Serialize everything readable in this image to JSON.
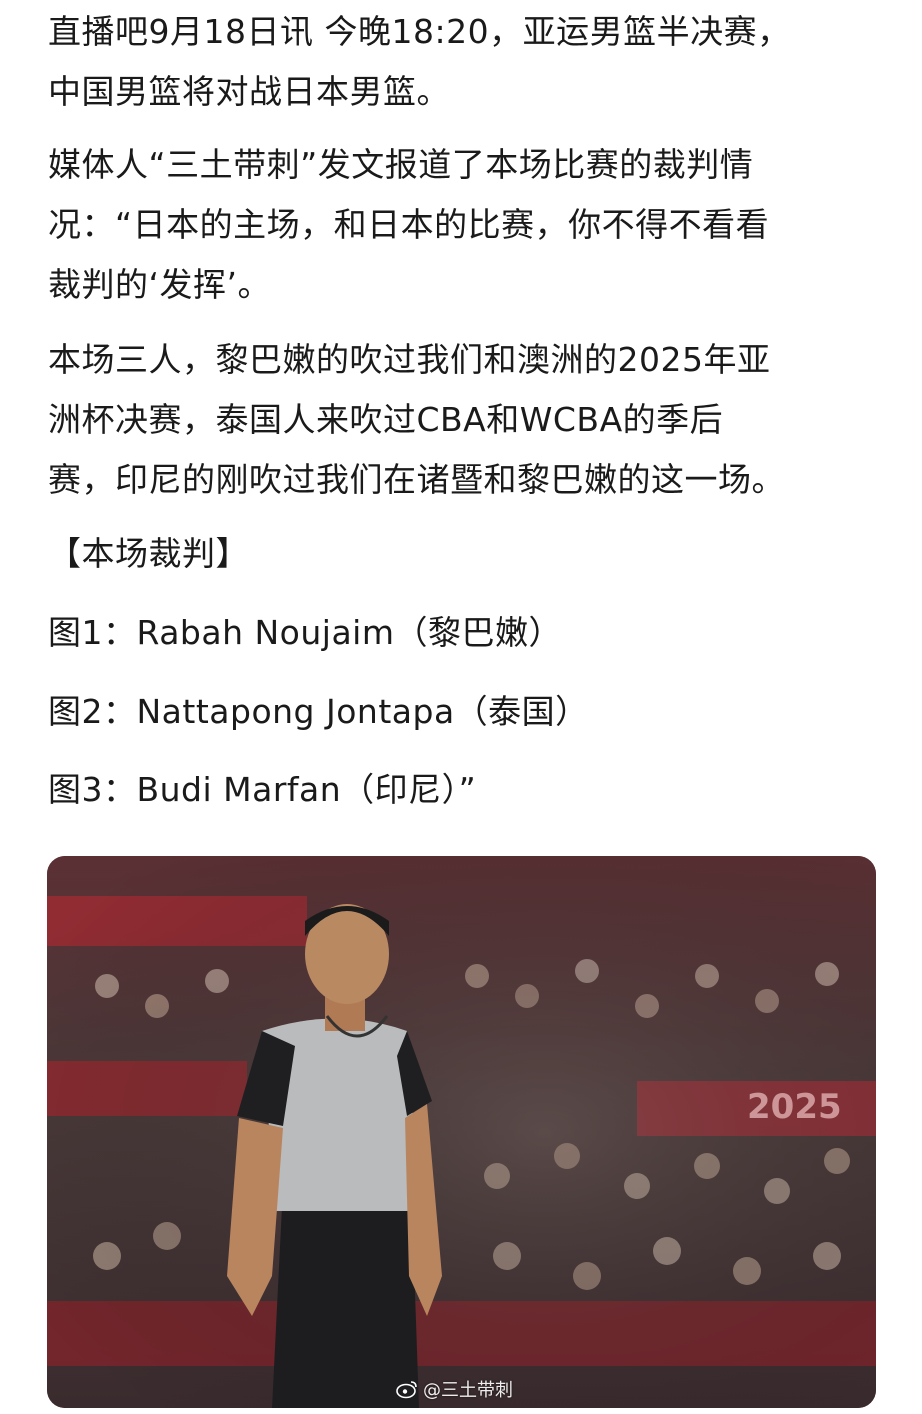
{
  "article": {
    "p1": "直播吧9月18日讯 今晚18:20，亚运男篮半决赛，\n中国男篮将对战日本男篮。",
    "p2": "媒体人“三土带刺”发文报道了本场比赛的裁判情\n况：“日本的主场，和日本的比赛，你不得不看看\n裁判的‘发挥’。",
    "p3": "本场三人，黎巴嫩的吹过我们和澳洲的2025年亚\n洲杯决赛，泰国人来吹过CBA和WCBA的季后\n赛，印尼的刚吹过我们在诸暨和黎巴嫩的这一场。",
    "p4": "【本场裁判】",
    "p5": "图1：Rabah Noujaim（黎巴嫩）",
    "p6": "图2：Nattapong Jontapa（泰国）",
    "p7": "图3：Budi Marfan（印尼）”"
  },
  "photo": {
    "banner_text": "2025",
    "watermark": "@三土带刺"
  },
  "colors": {
    "text": "#1a1a1a",
    "crowd_red": "#8e2a31",
    "jersey_gray": "#b9bbbd"
  }
}
